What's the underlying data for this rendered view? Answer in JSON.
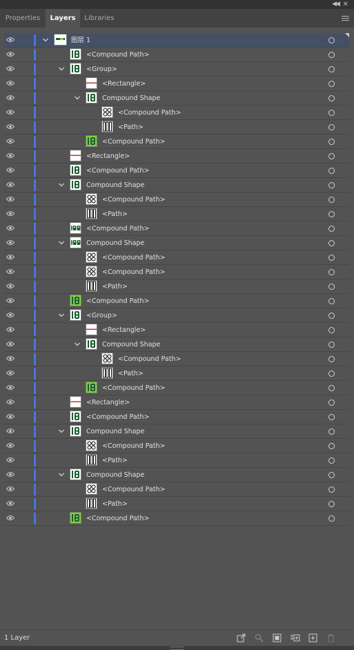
{
  "window": {
    "collapse_icon": "double-chevron-left-icon",
    "close_icon": "close-icon"
  },
  "tabs": [
    {
      "label": "Properties",
      "active": false
    },
    {
      "label": "Layers",
      "active": true
    },
    {
      "label": "Libraries",
      "active": false
    }
  ],
  "colors": {
    "panel_bg": "#535353",
    "selected_row": "#455066",
    "layer_color": "#4a73e3",
    "thumb_dark_green": "#1f5c33",
    "thumb_light_green": "#7fd13b"
  },
  "rows": [
    {
      "label": "图层 1",
      "indent": 0,
      "expandable": true,
      "thumb": "layer",
      "selected": true
    },
    {
      "label": "<Compound Path>",
      "indent": 1,
      "expandable": false,
      "thumb": "18-dark"
    },
    {
      "label": "<Group>",
      "indent": 1,
      "expandable": true,
      "thumb": "18-dark"
    },
    {
      "label": "<Rectangle>",
      "indent": 2,
      "expandable": false,
      "thumb": "rect"
    },
    {
      "label": "Compound Shape",
      "indent": 2,
      "expandable": true,
      "thumb": "18-dark"
    },
    {
      "label": "<Compound Path>",
      "indent": 3,
      "expandable": false,
      "thumb": "88-outline"
    },
    {
      "label": "<Path>",
      "indent": 3,
      "expandable": false,
      "thumb": "bars"
    },
    {
      "label": "<Compound Path>",
      "indent": 2,
      "expandable": false,
      "thumb": "18-light"
    },
    {
      "label": "<Rectangle>",
      "indent": 1,
      "expandable": false,
      "thumb": "rect"
    },
    {
      "label": "<Compound Path>",
      "indent": 1,
      "expandable": false,
      "thumb": "18-dark"
    },
    {
      "label": "Compound Shape",
      "indent": 1,
      "expandable": true,
      "thumb": "18-dark"
    },
    {
      "label": "<Compound Path>",
      "indent": 2,
      "expandable": false,
      "thumb": "88-outline"
    },
    {
      "label": "<Path>",
      "indent": 2,
      "expandable": false,
      "thumb": "bars"
    },
    {
      "label": "<Compound Path>",
      "indent": 1,
      "expandable": false,
      "thumb": "188-dark"
    },
    {
      "label": "Compound Shape",
      "indent": 1,
      "expandable": true,
      "thumb": "188-dark"
    },
    {
      "label": "<Compound Path>",
      "indent": 2,
      "expandable": false,
      "thumb": "88-outline"
    },
    {
      "label": "<Compound Path>",
      "indent": 2,
      "expandable": false,
      "thumb": "88-outline"
    },
    {
      "label": "<Path>",
      "indent": 2,
      "expandable": false,
      "thumb": "bars"
    },
    {
      "label": "<Compound Path>",
      "indent": 1,
      "expandable": false,
      "thumb": "18-light"
    },
    {
      "label": "<Group>",
      "indent": 1,
      "expandable": true,
      "thumb": "18-dark"
    },
    {
      "label": "<Rectangle>",
      "indent": 2,
      "expandable": false,
      "thumb": "rect"
    },
    {
      "label": "Compound Shape",
      "indent": 2,
      "expandable": true,
      "thumb": "18-dark"
    },
    {
      "label": "<Compound Path>",
      "indent": 3,
      "expandable": false,
      "thumb": "88-outline"
    },
    {
      "label": "<Path>",
      "indent": 3,
      "expandable": false,
      "thumb": "bars"
    },
    {
      "label": "<Compound Path>",
      "indent": 2,
      "expandable": false,
      "thumb": "18-light"
    },
    {
      "label": "<Rectangle>",
      "indent": 1,
      "expandable": false,
      "thumb": "rect"
    },
    {
      "label": "<Compound Path>",
      "indent": 1,
      "expandable": false,
      "thumb": "18-dark"
    },
    {
      "label": "Compound Shape",
      "indent": 1,
      "expandable": true,
      "thumb": "18-dark"
    },
    {
      "label": "<Compound Path>",
      "indent": 2,
      "expandable": false,
      "thumb": "88-outline"
    },
    {
      "label": "<Path>",
      "indent": 2,
      "expandable": false,
      "thumb": "bars"
    },
    {
      "label": "Compound Shape",
      "indent": 1,
      "expandable": true,
      "thumb": "18-dark"
    },
    {
      "label": "<Compound Path>",
      "indent": 2,
      "expandable": false,
      "thumb": "88-outline"
    },
    {
      "label": "<Path>",
      "indent": 2,
      "expandable": false,
      "thumb": "bars"
    },
    {
      "label": "<Compound Path>",
      "indent": 1,
      "expandable": false,
      "thumb": "18-light"
    }
  ],
  "footer": {
    "layer_count": "1 Layer",
    "buttons": [
      {
        "name": "export-icon"
      },
      {
        "name": "locate-object-icon"
      },
      {
        "name": "make-clipping-mask-icon"
      },
      {
        "name": "create-sublayer-icon"
      },
      {
        "name": "new-layer-icon"
      },
      {
        "name": "trash-icon"
      }
    ]
  }
}
